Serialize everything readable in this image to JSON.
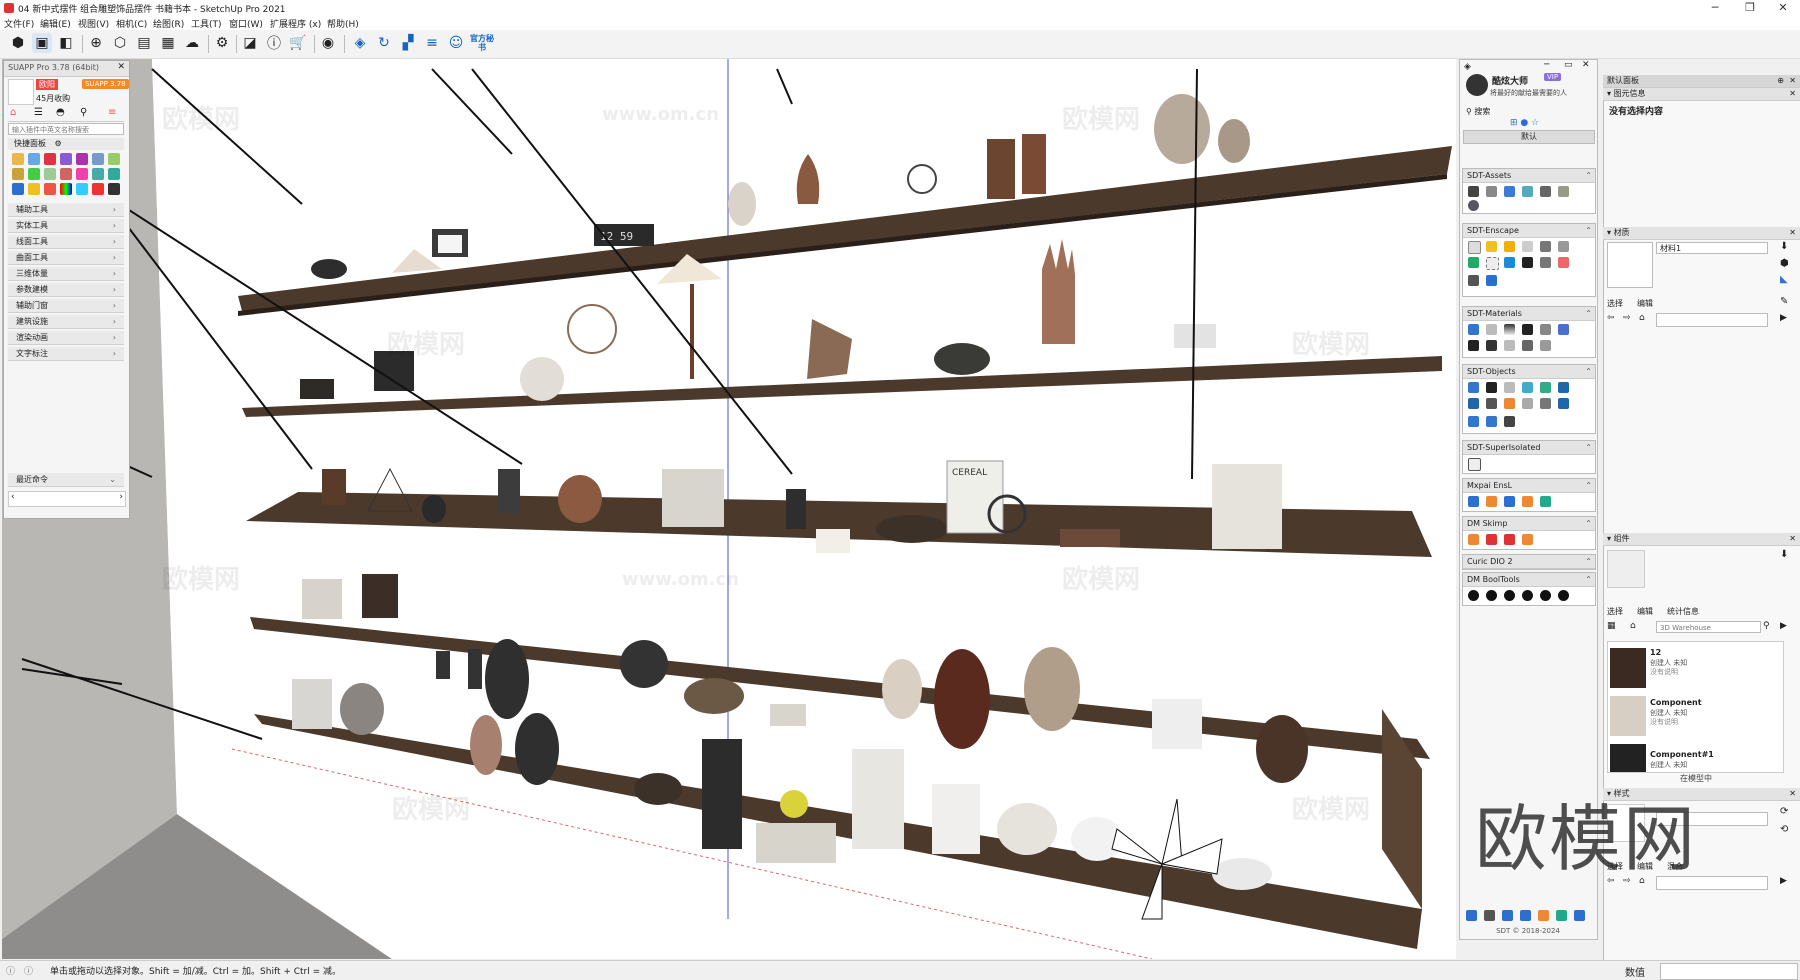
{
  "window": {
    "title": "04 新中式摆件 组合雕塑饰品摆件 书籍书本 - SketchUp Pro 2021",
    "controls": [
      "─",
      "❐",
      "✕"
    ]
  },
  "menu": [
    "文件(F)",
    "编辑(E)",
    "视图(V)",
    "相机(C)",
    "绘图(R)",
    "工具(T)",
    "窗口(W)",
    "扩展程序 (x)",
    "帮助(H)"
  ],
  "toolbar": {
    "icons": [
      "select-icon",
      "component-icon",
      "paint-icon",
      "orbit-icon",
      "warehouse-icon",
      "layers-icon",
      "materials-icon",
      "cloud-icon",
      "settings-icon",
      "shadow-icon",
      "info-icon",
      "cart-icon",
      "user-icon",
      "enscape-icon",
      "sync-icon",
      "grid-icon",
      "sliders-icon",
      "account-icon"
    ],
    "official_label": "官方秘书"
  },
  "suapp": {
    "title": "SUAPP Pro 3.78 (64bit)",
    "badge": "SUAPP 3.78",
    "user_badge": "欧阳",
    "subscription": "45月收购",
    "search_placeholder": "输入插件中英文名称搜索",
    "quick_panel": "快捷面板",
    "categories": [
      "辅助工具",
      "实体工具",
      "线面工具",
      "曲面工具",
      "三维体量",
      "参数建模",
      "辅助门窗",
      "建筑设施",
      "渲染动画",
      "文字标注"
    ],
    "recent": "最近命令"
  },
  "sdt": {
    "brand": "酷炫大师",
    "vip": "VIP",
    "slogan": "将最好的献给最需要的人",
    "search": "搜索",
    "default_label": "默认",
    "sections": [
      {
        "name": "SDT-Assets",
        "icons": [
          "cube",
          "list",
          "db",
          "link",
          "home",
          "box",
          "circle"
        ]
      },
      {
        "name": "SDT-Enscape",
        "icons": [
          "doc",
          "bulb",
          "hex",
          "hex2",
          "star",
          "cube",
          "box",
          "crop",
          "square",
          "contrast",
          "panel",
          "close",
          "monitor",
          "text"
        ]
      },
      {
        "name": "SDT-Materials",
        "icons": [
          "ab",
          "page",
          "fade",
          "bucket",
          "gear",
          "cube",
          "pixel",
          "grid",
          "pattern",
          "spot",
          "knife"
        ]
      },
      {
        "name": "SDT-Objects",
        "icons": [
          "frame",
          "box",
          "copy",
          "rotate",
          "link",
          "tree",
          "pen",
          "cube",
          "cut",
          "nodes",
          "roof",
          "expand",
          "resize",
          "scale",
          "square"
        ]
      },
      {
        "name": "SDT-SuperIsolated",
        "icons": [
          "isolate"
        ]
      },
      {
        "name": "Mxpai EnsL",
        "icons": [
          "plus",
          "cross",
          "move",
          "push",
          "person"
        ]
      },
      {
        "name": "DM Skimp",
        "icons": [
          "down",
          "stack",
          "layers",
          "gears"
        ]
      },
      {
        "name": "Curic DIO 2",
        "icons": []
      },
      {
        "name": "DM BoolTools",
        "icons": [
          "b1",
          "b2",
          "b3",
          "b4",
          "b5",
          "b6"
        ]
      }
    ],
    "footer": "SDT © 2018-2024"
  },
  "tray": {
    "title": "默认面板",
    "entity_info": "图元信息",
    "entity_info_body": "没有选择内容",
    "materials": "材质",
    "material_name": "材料1",
    "select_tab": "选择",
    "edit_tab": "编辑",
    "components": "组件",
    "stats_tab": "统计信息",
    "warehouse_placeholder": "3D Warehouse",
    "component_items": [
      {
        "name": "12",
        "creator": "创建人 未知",
        "desc": "没有说明"
      },
      {
        "name": "Component",
        "creator": "创建人 未知",
        "desc": "没有说明"
      },
      {
        "name": "Component#1",
        "creator": "创建人 未知",
        "desc": ""
      }
    ],
    "in_model": "在模型中",
    "styles": "样式",
    "mix_tab": "混合"
  },
  "viewport": {
    "watermarks": [
      "欧模网",
      "www.om.cn"
    ],
    "corner_watermark": "欧模网",
    "shelf_labels": [
      "CEREAL",
      "12 59"
    ]
  },
  "status": {
    "hint": "单击或拖动以选择对象。Shift = 加/减。Ctrl = 加。Shift + Ctrl = 减。",
    "measure_label": "数值"
  }
}
